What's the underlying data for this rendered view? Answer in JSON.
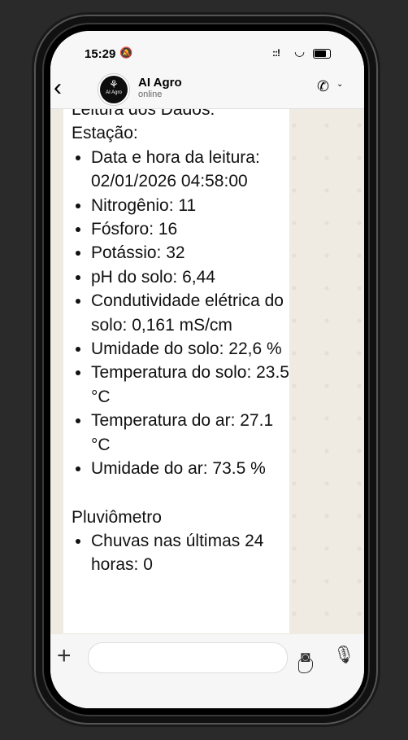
{
  "status_bar": {
    "time": "15:29",
    "signal": "::!"
  },
  "header": {
    "name": "AI Agro",
    "status": "online",
    "avatar_text": "AI Agro"
  },
  "message": {
    "title": "Leitura dos Dados:",
    "section1_title": "Estação:",
    "items": [
      "Data e hora da leitura: 02/01/2026 04:58:00",
      "Nitrogênio: 11",
      "Fósforo: 16",
      "Potássio: 32",
      "pH do solo: 6,44",
      "Condutividade elétrica do solo: 0,161 mS/cm",
      "Umidade do solo: 22,6 %",
      "Temperatura do solo: 23.5 °C",
      "Temperatura do ar: 27.1 °C",
      "Umidade do ar: 73.5 %"
    ],
    "section2_title": "Pluviômetro",
    "items2": [
      "Chuvas nas últimas 24 horas: 0"
    ]
  },
  "input": {
    "placeholder": ""
  }
}
